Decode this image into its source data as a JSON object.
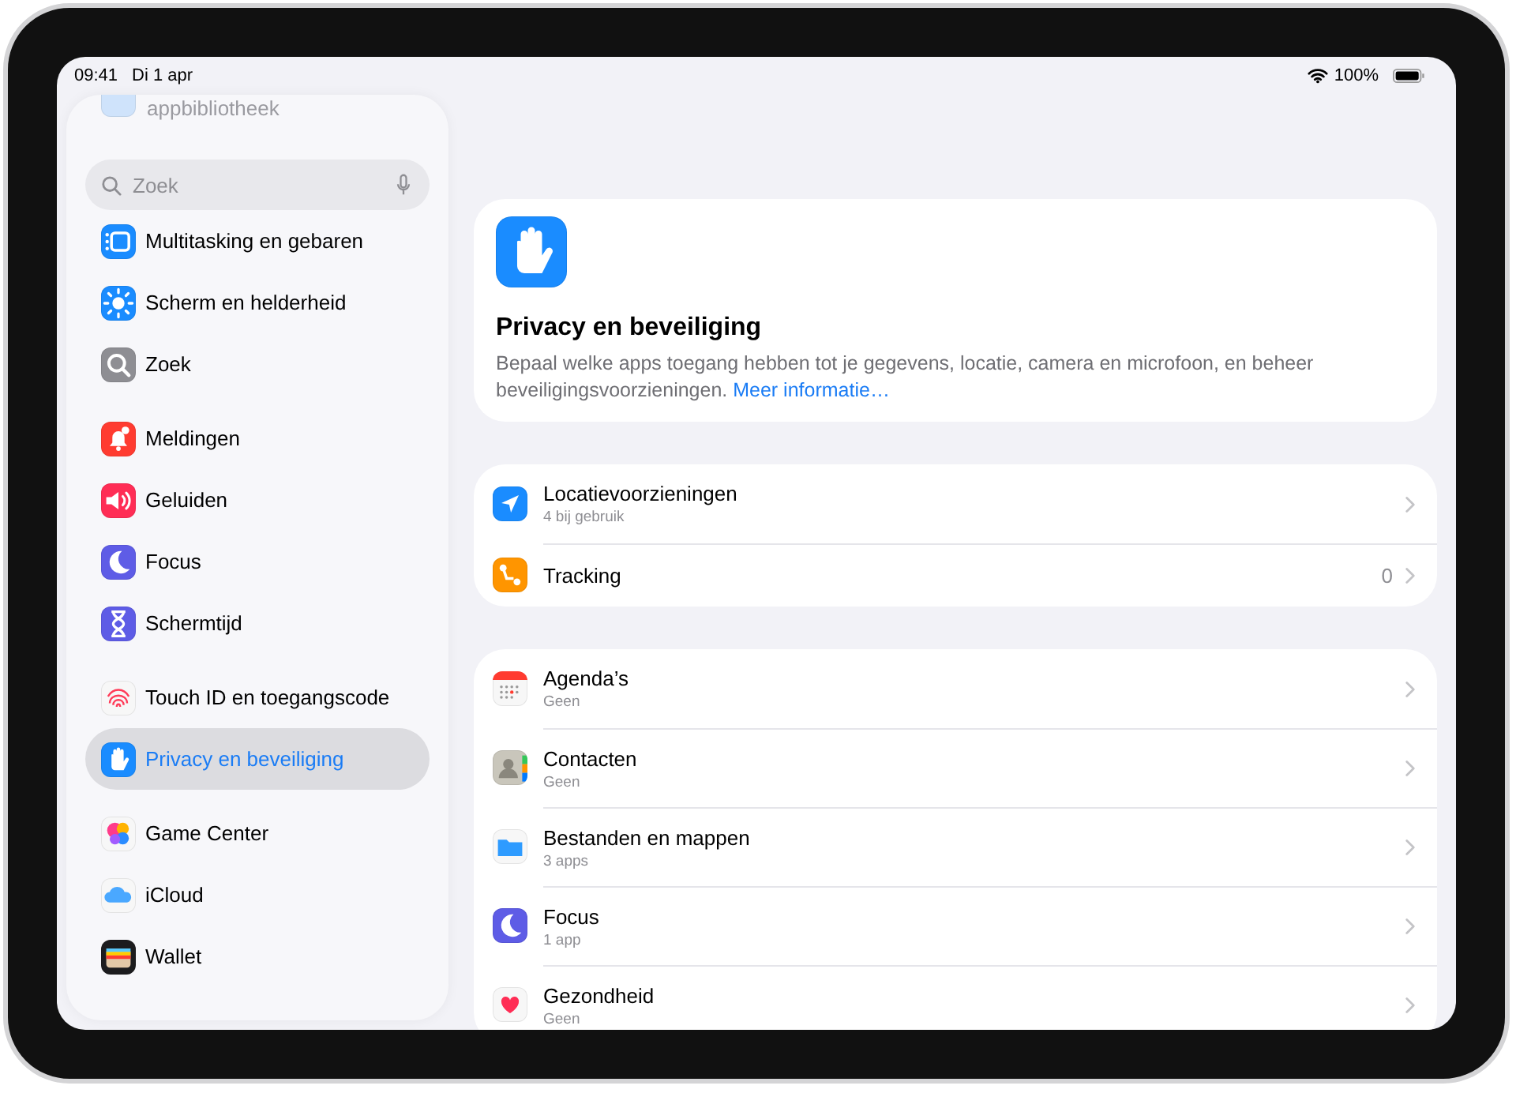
{
  "status_bar": {
    "time": "09:41",
    "date": "Di 1 apr",
    "battery": "100%"
  },
  "sidebar": {
    "faded_item": {
      "label": "appbibliotheek",
      "color": "#cfe3fb"
    },
    "search": {
      "placeholder": "Zoek"
    },
    "groups": [
      [
        {
          "label": "Multitasking en gebaren",
          "kind": "multitasking",
          "color": "#1a8cff",
          "selected": false
        },
        {
          "label": "Scherm en helderheid",
          "kind": "sun",
          "color": "#1a8cff",
          "selected": false
        },
        {
          "label": "Zoek",
          "kind": "search",
          "color": "#8e8e93",
          "selected": false
        }
      ],
      [
        {
          "label": "Meldingen",
          "kind": "bell",
          "color": "#ff3b30",
          "selected": false
        },
        {
          "label": "Geluiden",
          "kind": "speaker",
          "color": "#ff2d55",
          "selected": false
        },
        {
          "label": "Focus",
          "kind": "moon",
          "color": "#5e5ce6",
          "selected": false
        },
        {
          "label": "Schermtijd",
          "kind": "hourglass",
          "color": "#5e5ce6",
          "selected": false
        }
      ],
      [
        {
          "label": "Touch ID en toegangscode",
          "kind": "fingerprint",
          "color": "#f7f7f7",
          "selected": false
        },
        {
          "label": "Privacy en beveiliging",
          "kind": "hand",
          "color": "#1a8cff",
          "selected": true
        }
      ],
      [
        {
          "label": "Game Center",
          "kind": "bubbles",
          "color": "#f7f7f7",
          "selected": false
        },
        {
          "label": "iCloud",
          "kind": "cloud",
          "color": "#f7f7f7",
          "selected": false
        },
        {
          "label": "Wallet",
          "kind": "wallet",
          "color": "#1c1c1e",
          "selected": false
        }
      ]
    ]
  },
  "header": {
    "color": "#1a8cff",
    "title": "Privacy en beveiliging",
    "description": "Bepaal welke apps toegang hebben tot je gegevens, locatie, camera en microfoon, en beheer beveiligingsvoorzieningen.",
    "link": "Meer informatie…"
  },
  "sections": [
    {
      "rows": [
        {
          "label": "Locatievoorzieningen",
          "detail": "4 bij gebruik",
          "kind": "location",
          "color": "#1a8cff"
        },
        {
          "label": "Tracking",
          "value": "0",
          "kind": "tracking",
          "color": "#ff9500"
        }
      ]
    },
    {
      "rows": [
        {
          "label": "Agenda’s",
          "detail": "Geen",
          "kind": "calendar",
          "color": "#f7f7f7"
        },
        {
          "label": "Contacten",
          "detail": "Geen",
          "kind": "contacts",
          "color": "#c9c6bb"
        },
        {
          "label": "Bestanden en mappen",
          "detail": "3 apps",
          "kind": "folder",
          "color": "#f7f7f7"
        },
        {
          "label": "Focus",
          "detail": "1 app",
          "kind": "moon",
          "color": "#5e5ce6"
        },
        {
          "label": "Gezondheid",
          "detail": "Geen",
          "kind": "heart",
          "color": "#f7f7f7"
        }
      ]
    }
  ]
}
